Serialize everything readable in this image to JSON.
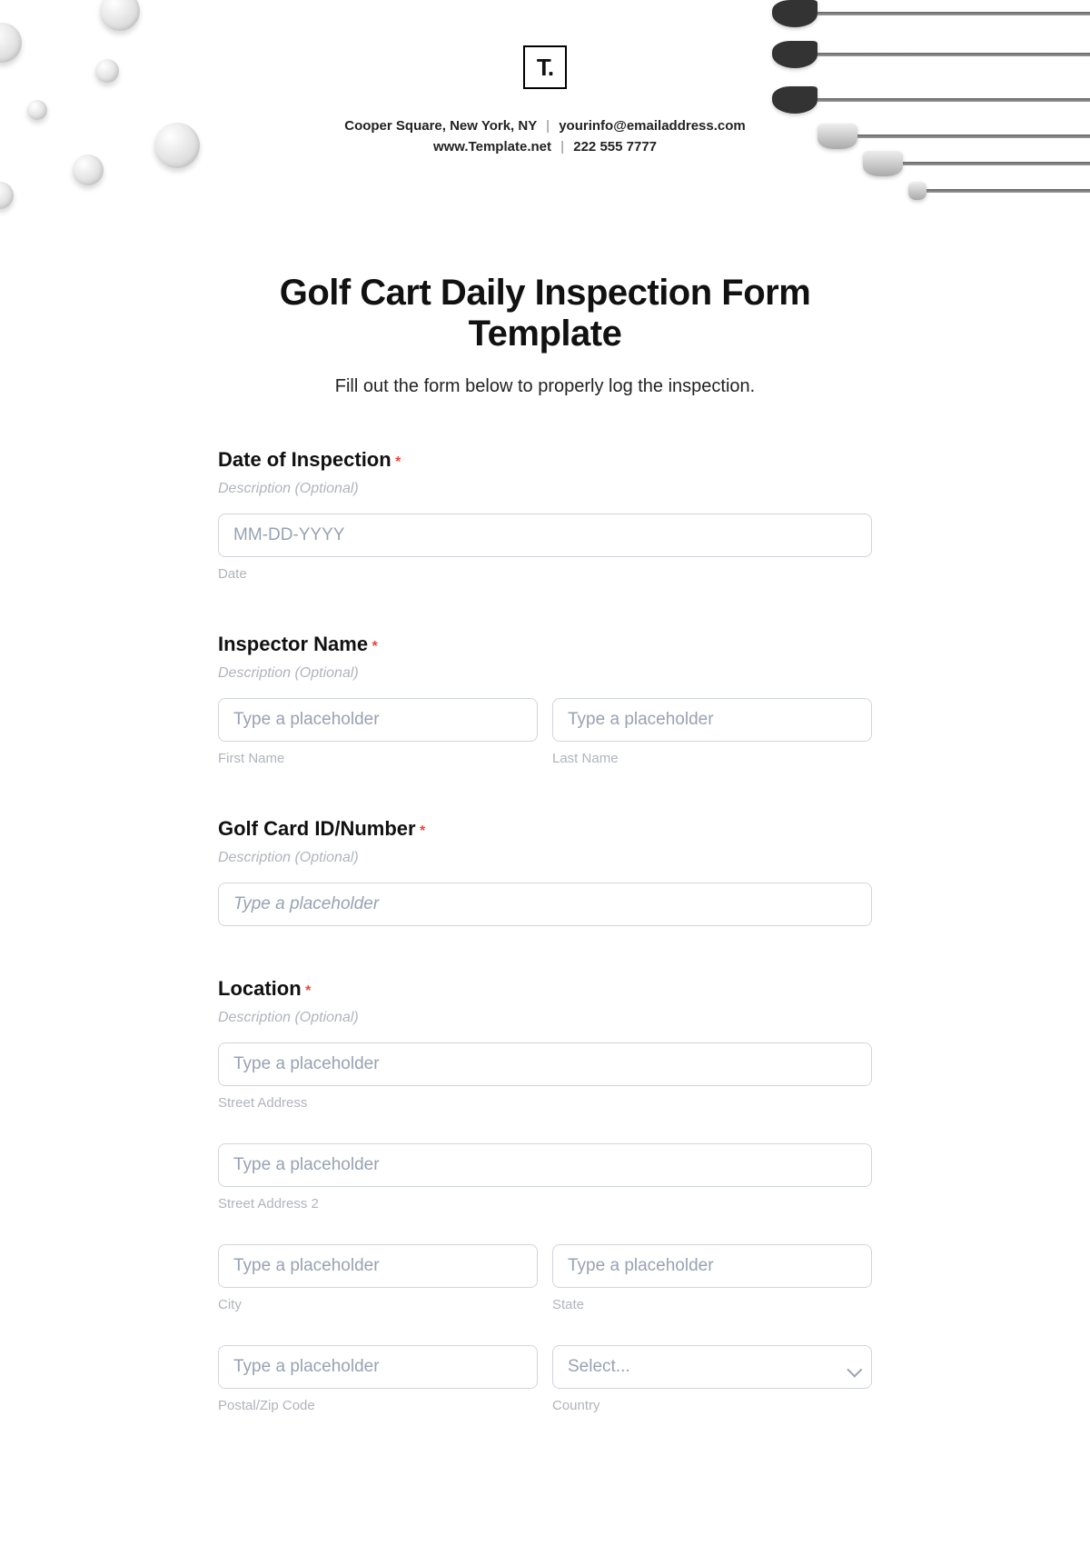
{
  "header": {
    "logo_text": "T.",
    "address": "Cooper Square, New York, NY",
    "email": "yourinfo@emailaddress.com",
    "website": "www.Template.net",
    "phone": "222 555 7777"
  },
  "page": {
    "title": "Golf Cart Daily Inspection Form Template",
    "subtitle": "Fill out the form below to properly log the inspection."
  },
  "fields": {
    "date": {
      "label": "Date of Inspection",
      "required": "*",
      "description": "Description (Optional)",
      "placeholder": "MM-DD-YYYY",
      "sublabel": "Date"
    },
    "inspector": {
      "label": "Inspector Name",
      "required": "*",
      "description": "Description (Optional)",
      "first_placeholder": "Type a placeholder",
      "first_sublabel": "First Name",
      "last_placeholder": "Type a placeholder",
      "last_sublabel": "Last Name"
    },
    "cart_id": {
      "label": "Golf Card ID/Number",
      "required": "*",
      "description": "Description (Optional)",
      "placeholder": "Type a placeholder"
    },
    "location": {
      "label": "Location",
      "required": "*",
      "description": "Description (Optional)",
      "street1_placeholder": "Type a placeholder",
      "street1_sublabel": "Street Address",
      "street2_placeholder": "Type a placeholder",
      "street2_sublabel": "Street Address 2",
      "city_placeholder": "Type a placeholder",
      "city_sublabel": "City",
      "state_placeholder": "Type a placeholder",
      "state_sublabel": "State",
      "zip_placeholder": "Type a placeholder",
      "zip_sublabel": "Postal/Zip Code",
      "country_placeholder": "Select...",
      "country_sublabel": "Country"
    }
  }
}
